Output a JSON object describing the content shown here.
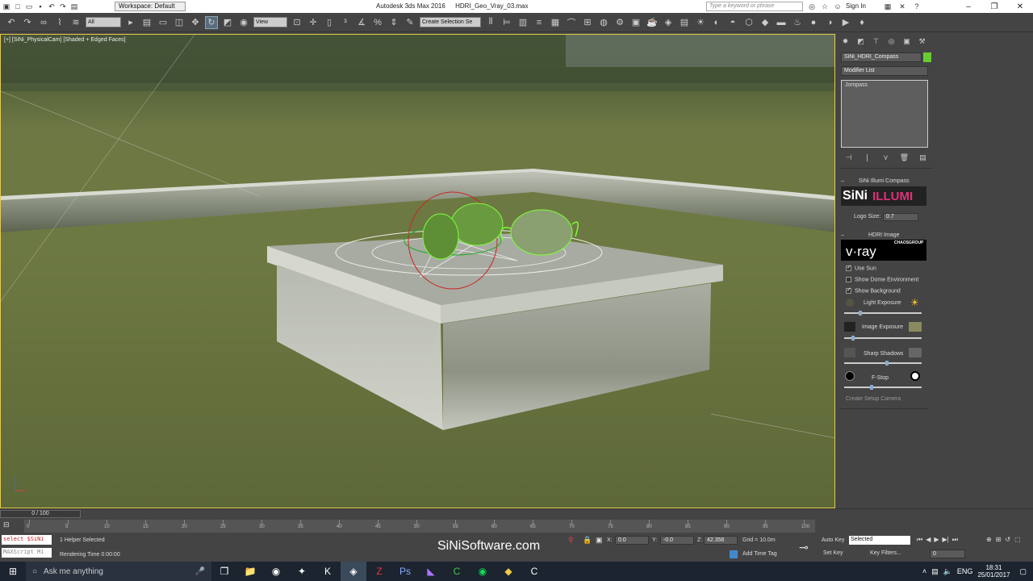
{
  "titlebar": {
    "workspace": "Workspace: Default",
    "app_name": "Autodesk 3ds Max 2016",
    "file_name": "HDRI_Geo_Vray_03.max",
    "search_placeholder": "Type a keyword or phrase",
    "sign_in": "Sign In"
  },
  "toolbar": {
    "filter_value": "All",
    "refcoord_value": "View",
    "selection_set_placeholder": "Create Selection Se"
  },
  "viewport": {
    "label": "[+] [SiNi_PhysicalCam] [Shaded + Edged Faces]"
  },
  "command_panel": {
    "object_name": "SiNi_HDRI_Compass",
    "modifier_list": "Modifier List",
    "stack_item": "Jompass",
    "illumi_rollout_title": "SiNi Illumi Compass",
    "logo_sini": "SiNi",
    "logo_illumi": "ILLUMI",
    "logo_size_label": "Logo Size:",
    "logo_size_value": "0.7",
    "hdri_rollout_title": "HDRI Image",
    "vray_logo": "v·ray",
    "chaos_label": "CHAOSGROUP",
    "use_sun_label": "Use Sun",
    "show_dome_label": "Show Dome Environment",
    "show_background_label": "Show Background",
    "light_exposure_label": "Light Exposure",
    "image_exposure_label": "Image Exposure",
    "sharp_shadows_label": "Sharp Shadows",
    "fstop_label": "F-Stop",
    "create_camera_label": "Create Setup Camera",
    "light_exposure_value": 0.2,
    "image_exposure_value": 0.1,
    "sharp_shadows_value": 0.55,
    "fstop_value": 0.35
  },
  "timeline": {
    "frame_display": "0 / 100",
    "ticks": [
      "0",
      "5",
      "10",
      "15",
      "20",
      "25",
      "30",
      "35",
      "40",
      "45",
      "50",
      "55",
      "60",
      "65",
      "70",
      "75",
      "80",
      "85",
      "90",
      "95",
      "100"
    ]
  },
  "status": {
    "maxscript_prompt": "select $SiNi",
    "maxscript_label": "MAXScript Mi",
    "selection_info": "1 Helper Selected",
    "render_time": "Rendering Time 0:00:00",
    "watermark": "SiNiSoftware.com",
    "x_label": "X:",
    "x_value": "0.0",
    "y_label": "Y:",
    "y_value": "-0.0",
    "z_label": "Z:",
    "z_value": "42.356",
    "grid": "Grid = 10.0m",
    "add_time_tag": "Add Time Tag",
    "auto_key": "Auto Key",
    "set_key": "Set Key",
    "selected_dropdown": "Selected",
    "key_filters": "Key Filters...",
    "frame_field": "0"
  },
  "taskbar": {
    "search_text": "Ask me anything",
    "language": "ENG",
    "time": "18:31",
    "date": "25/01/2017"
  }
}
